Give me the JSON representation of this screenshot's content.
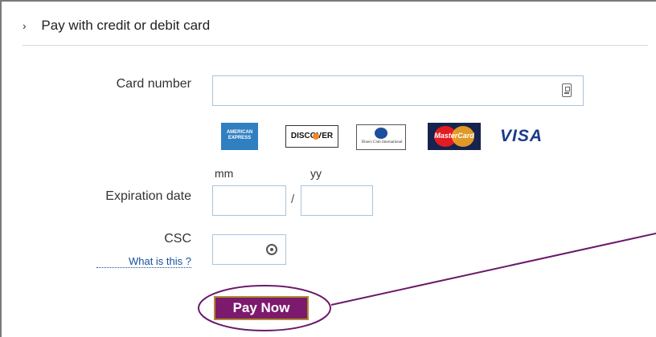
{
  "header": {
    "chevron": "›",
    "title": "Pay with credit or debit card"
  },
  "form": {
    "card_number_label": "Card number",
    "card_number_value": "",
    "expiration_label": "Expiration date",
    "mm_label": "mm",
    "yy_label": "yy",
    "separator": "/",
    "mm_value": "",
    "yy_value": "",
    "csc_label": "CSC",
    "csc_help": "What is this ?",
    "csc_value": ""
  },
  "cards": {
    "amex_text": "AMERICAN EXPRESS",
    "discover_text": "DISCOVER",
    "diners_text": "Diners Club International",
    "mastercard_text": "MasterCard",
    "visa_text": "VISA"
  },
  "button": {
    "pay_label": "Pay Now"
  },
  "icons": {
    "card_field_icon": "card-scan-icon",
    "csc_field_icon": "lock-circle-icon"
  },
  "colors": {
    "button_bg": "#7c1a6e",
    "annotation": "#6b1a6b",
    "input_border": "#a9c3de",
    "link": "#1a4f9c"
  }
}
